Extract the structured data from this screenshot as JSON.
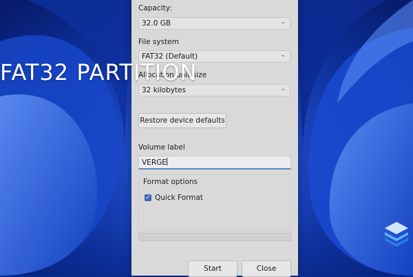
{
  "overlay": {
    "title": "FAT32 PARTITION"
  },
  "dialog": {
    "capacity": {
      "label": "Capacity:",
      "value": "32.0 GB"
    },
    "file_system": {
      "label": "File system",
      "value": "FAT32 (Default)"
    },
    "allocation": {
      "label": "Allocation unit size",
      "value": "32 kilobytes"
    },
    "restore_button": "Restore device defaults",
    "volume_label": {
      "label": "Volume label",
      "value": "VERGE"
    },
    "format_options": {
      "title": "Format options",
      "quick_format": {
        "label": "Quick Format",
        "checked": true
      }
    },
    "start_button": "Start",
    "close_button": "Close"
  },
  "colors": {
    "wallpaper_dark": "#0a2580",
    "wallpaper_light": "#3b6ef0",
    "dialog_bg": "#d9d9d9",
    "accent": "#3c67b8"
  },
  "icons": {
    "dropdown": "chevron-down-icon",
    "check": "checkmark-icon",
    "brand": "stacked-layers-logo-icon"
  }
}
